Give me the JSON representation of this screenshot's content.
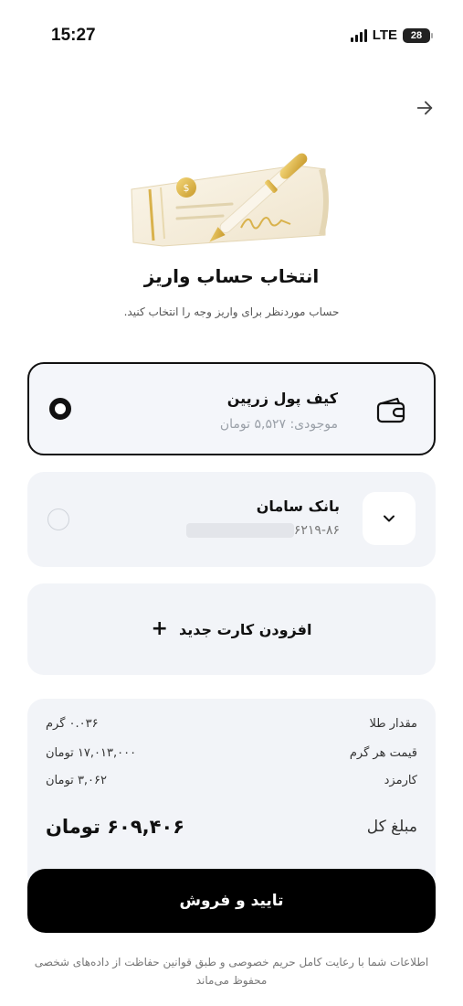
{
  "status_bar": {
    "time": "15:27",
    "network": "LTE",
    "battery": "28"
  },
  "header": {
    "back_icon": "arrow-right-icon"
  },
  "page": {
    "title": "انتخاب حساب واریز",
    "subtitle": "حساب مورد‌نظر برای واریز وجه را انتخاب کنید."
  },
  "accounts": {
    "wallet": {
      "name": "کیف پول زرپین",
      "balance": "موجودی: ۵,۵۲۷ تومان",
      "selected": true,
      "icon": "wallet-icon"
    },
    "bank": {
      "name": "بانک سامان",
      "card_number_prefix": "۶۲۱۹-۸۶",
      "selected": false,
      "icon": "chevron-down-icon"
    },
    "add_card_label": "افزودن کارت جدید"
  },
  "summary": {
    "gold_amount_label": "مقدار طلا",
    "gold_amount_value": "۰.۰۳۶ گرم",
    "price_per_gram_label": "قیمت هر گرم",
    "price_per_gram_value": "۱۷,۰۱۳,۰۰۰ تومان",
    "fee_label": "کارمزد",
    "fee_value": "۳,۰۶۲ تومان",
    "total_label": "مبلغ کل",
    "total_value": "۶۰۹,۴۰۶ تومان"
  },
  "confirm_button": "تایید و فروش",
  "footer": "اطلاعات شما با رعایت کامل حریم خصوصی و طبق قوانین حفاظت از داده‌های شخصی محفوظ می‌ماند",
  "colors": {
    "primary": "#000000",
    "card_bg": "#f2f4f8",
    "gold": "#d9b24c"
  }
}
